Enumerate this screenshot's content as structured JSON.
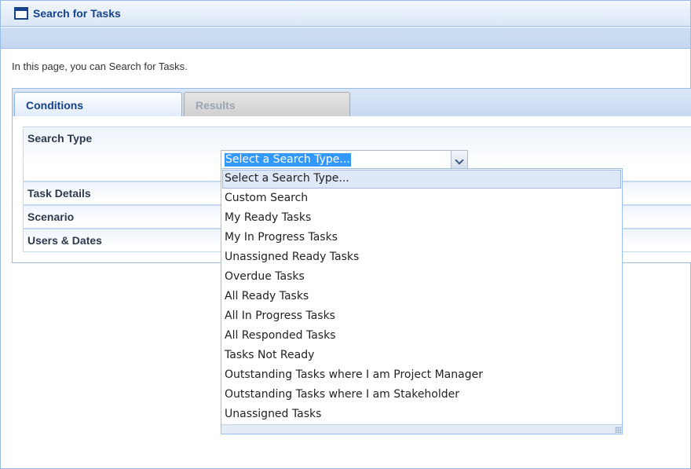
{
  "window": {
    "title": "Search for Tasks",
    "icon": "window-icon"
  },
  "intro": "In this page, you can Search for Tasks.",
  "tabs": [
    {
      "label": "Conditions",
      "active": true
    },
    {
      "label": "Results",
      "active": false
    }
  ],
  "sections": {
    "search_type": "Search Type",
    "task_details": "Task Details",
    "scenario": "Scenario",
    "users_dates": "Users & Dates"
  },
  "search_type_combo": {
    "value": "Select a Search Type...",
    "options": [
      "Select a Search Type...",
      "Custom Search",
      "My Ready Tasks",
      "My In Progress Tasks",
      "Unassigned Ready Tasks",
      "Overdue Tasks",
      "All Ready Tasks",
      "All In Progress Tasks",
      "All Responded Tasks",
      "Tasks Not Ready",
      "Outstanding Tasks where I am Project Manager",
      "Outstanding Tasks where I am Stakeholder",
      "Unassigned Tasks"
    ],
    "selected_index": 0
  },
  "colors": {
    "accent": "#15428b",
    "selection": "#3399ff",
    "border": "#99bbe8"
  }
}
